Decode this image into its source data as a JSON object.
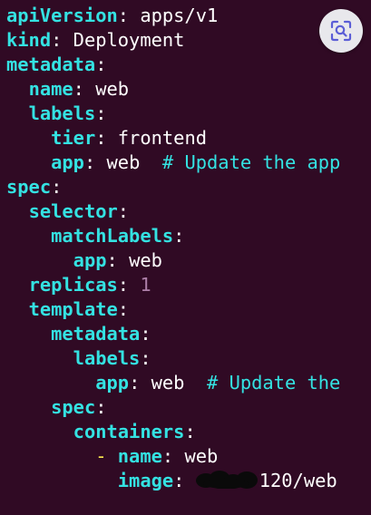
{
  "editor": {
    "lines": [
      {
        "key": "apiVersion",
        "sep": ": ",
        "value": "apps/v1"
      },
      {
        "key": "kind",
        "sep": ": ",
        "value": "Deployment"
      },
      {
        "key": "metadata",
        "sep": ":"
      },
      {
        "indent": "  ",
        "key": "name",
        "sep": ": ",
        "value": "web"
      },
      {
        "indent": "  ",
        "key": "labels",
        "sep": ":"
      },
      {
        "indent": "    ",
        "key": "tier",
        "sep": ": ",
        "value": "frontend"
      },
      {
        "indent": "    ",
        "key": "app",
        "sep": ": ",
        "value": "web",
        "comment": "  # Update the app"
      },
      {
        "key": "spec",
        "sep": ":"
      },
      {
        "indent": "  ",
        "key": "selector",
        "sep": ":"
      },
      {
        "indent": "    ",
        "key": "matchLabels",
        "sep": ":"
      },
      {
        "indent": "      ",
        "key": "app",
        "sep": ": ",
        "value": "web"
      },
      {
        "indent": "  ",
        "key": "replicas",
        "sep": ": ",
        "number": "1"
      },
      {
        "indent": "  ",
        "key": "template",
        "sep": ":"
      },
      {
        "indent": "    ",
        "key": "metadata",
        "sep": ":"
      },
      {
        "indent": "      ",
        "key": "labels",
        "sep": ":"
      },
      {
        "indent": "        ",
        "key": "app",
        "sep": ": ",
        "value": "web",
        "comment": "  # Update the"
      },
      {
        "indent": "    ",
        "key": "spec",
        "sep": ":"
      },
      {
        "indent": "      ",
        "key": "containers",
        "sep": ":"
      },
      {
        "indent": "        ",
        "dash": "- ",
        "key": "name",
        "sep": ": ",
        "value": "web"
      },
      {
        "indent": "          ",
        "key": "image",
        "sep": ": ",
        "redacted": true,
        "value": "120/web"
      }
    ]
  },
  "colors": {
    "background": "#300a24",
    "key": "#34e2e2",
    "text": "#ffffff",
    "number": "#ad7fa8",
    "comment": "#34e2e2",
    "dash": "#fce94f",
    "redaction": "#0a0a0a"
  },
  "overlay": {
    "icon": "lens-search-icon"
  }
}
